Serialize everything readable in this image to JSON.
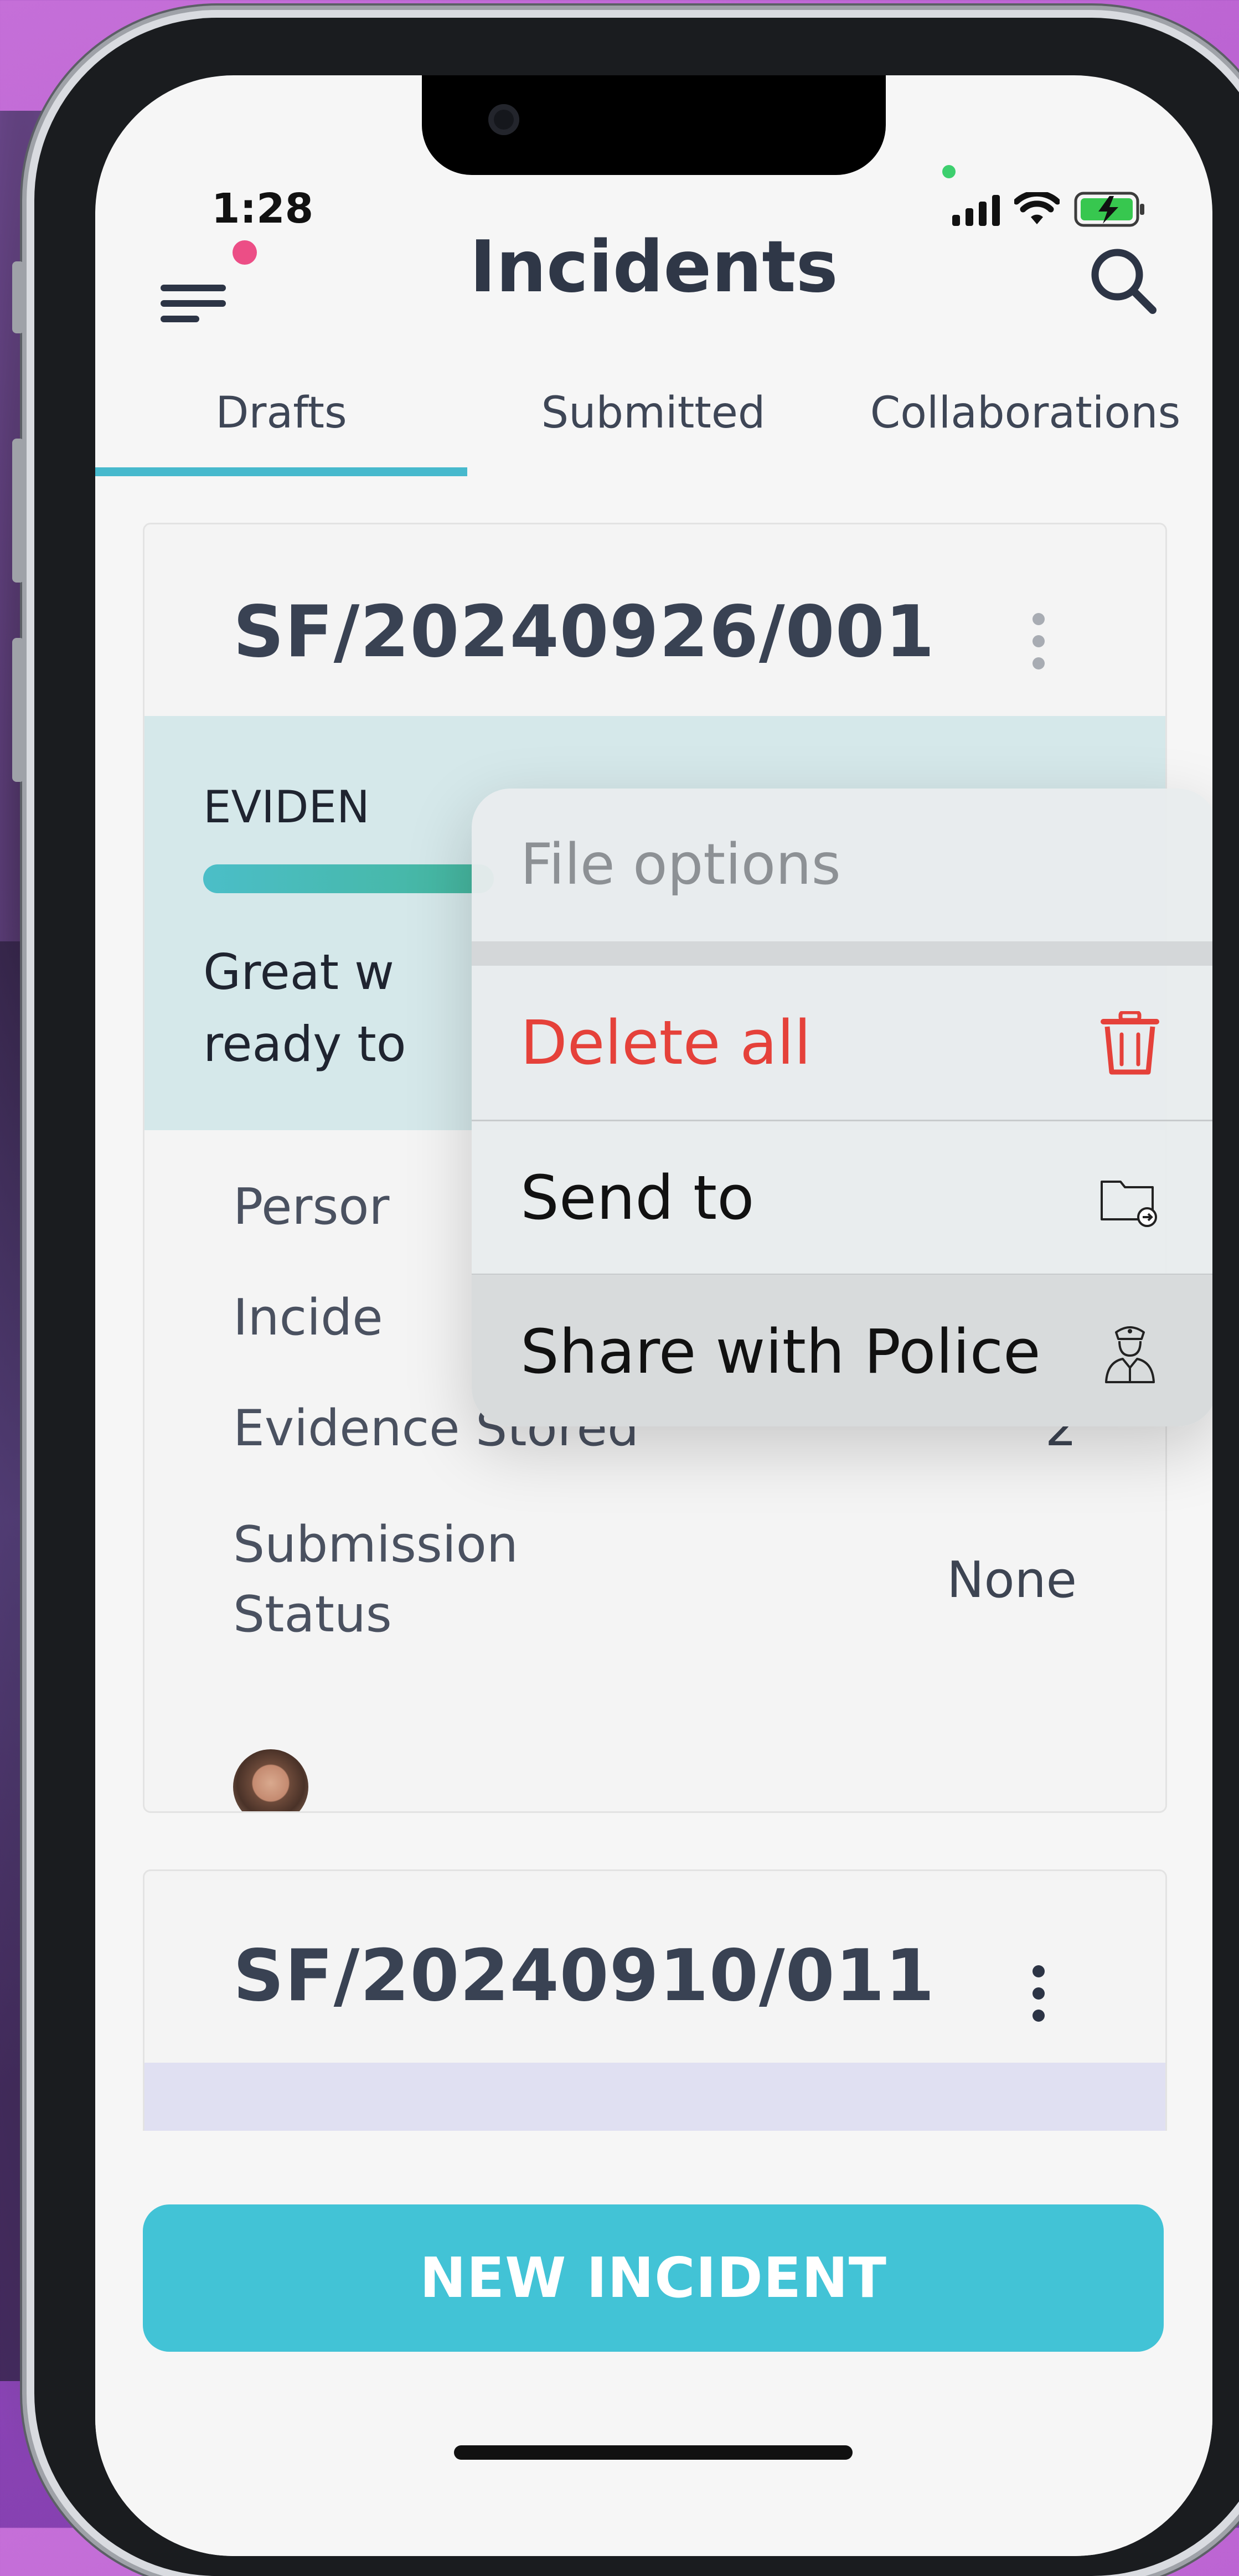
{
  "status_bar": {
    "time": "1:28"
  },
  "header": {
    "title": "Incidents",
    "menu_icon": "hamburger-menu-icon",
    "notification_dot_color": "#ec4e86",
    "search_icon": "search-icon"
  },
  "tabs": [
    {
      "label": "Drafts",
      "active": true
    },
    {
      "label": "Submitted",
      "active": false
    },
    {
      "label": "Collaborations",
      "active": false
    }
  ],
  "cards": [
    {
      "id": "SF/20240926/001",
      "evidence_label": "EVIDEN",
      "evidence_progress": 0.35,
      "message_line1": "Great w",
      "message_line2": "ready to",
      "rows": [
        {
          "label": "Persor",
          "value": ""
        },
        {
          "label": "Incide",
          "value": ""
        },
        {
          "label": "Evidence Stored",
          "value": "2"
        },
        {
          "label_line1": "Submission",
          "label_line2": "Status",
          "value": "None"
        }
      ]
    },
    {
      "id": "SF/20240910/011"
    }
  ],
  "file_options_menu": {
    "title": "File options",
    "items": [
      {
        "label": "Delete all",
        "icon": "trash-icon",
        "color": "#e5413a"
      },
      {
        "label": "Send to",
        "icon": "folder-send-icon",
        "color": "#111111"
      },
      {
        "label": "Share with Police",
        "icon": "police-officer-icon",
        "color": "#111111"
      }
    ]
  },
  "primary_button": {
    "label": "NEW INCIDENT",
    "color": "#42c3d6"
  }
}
